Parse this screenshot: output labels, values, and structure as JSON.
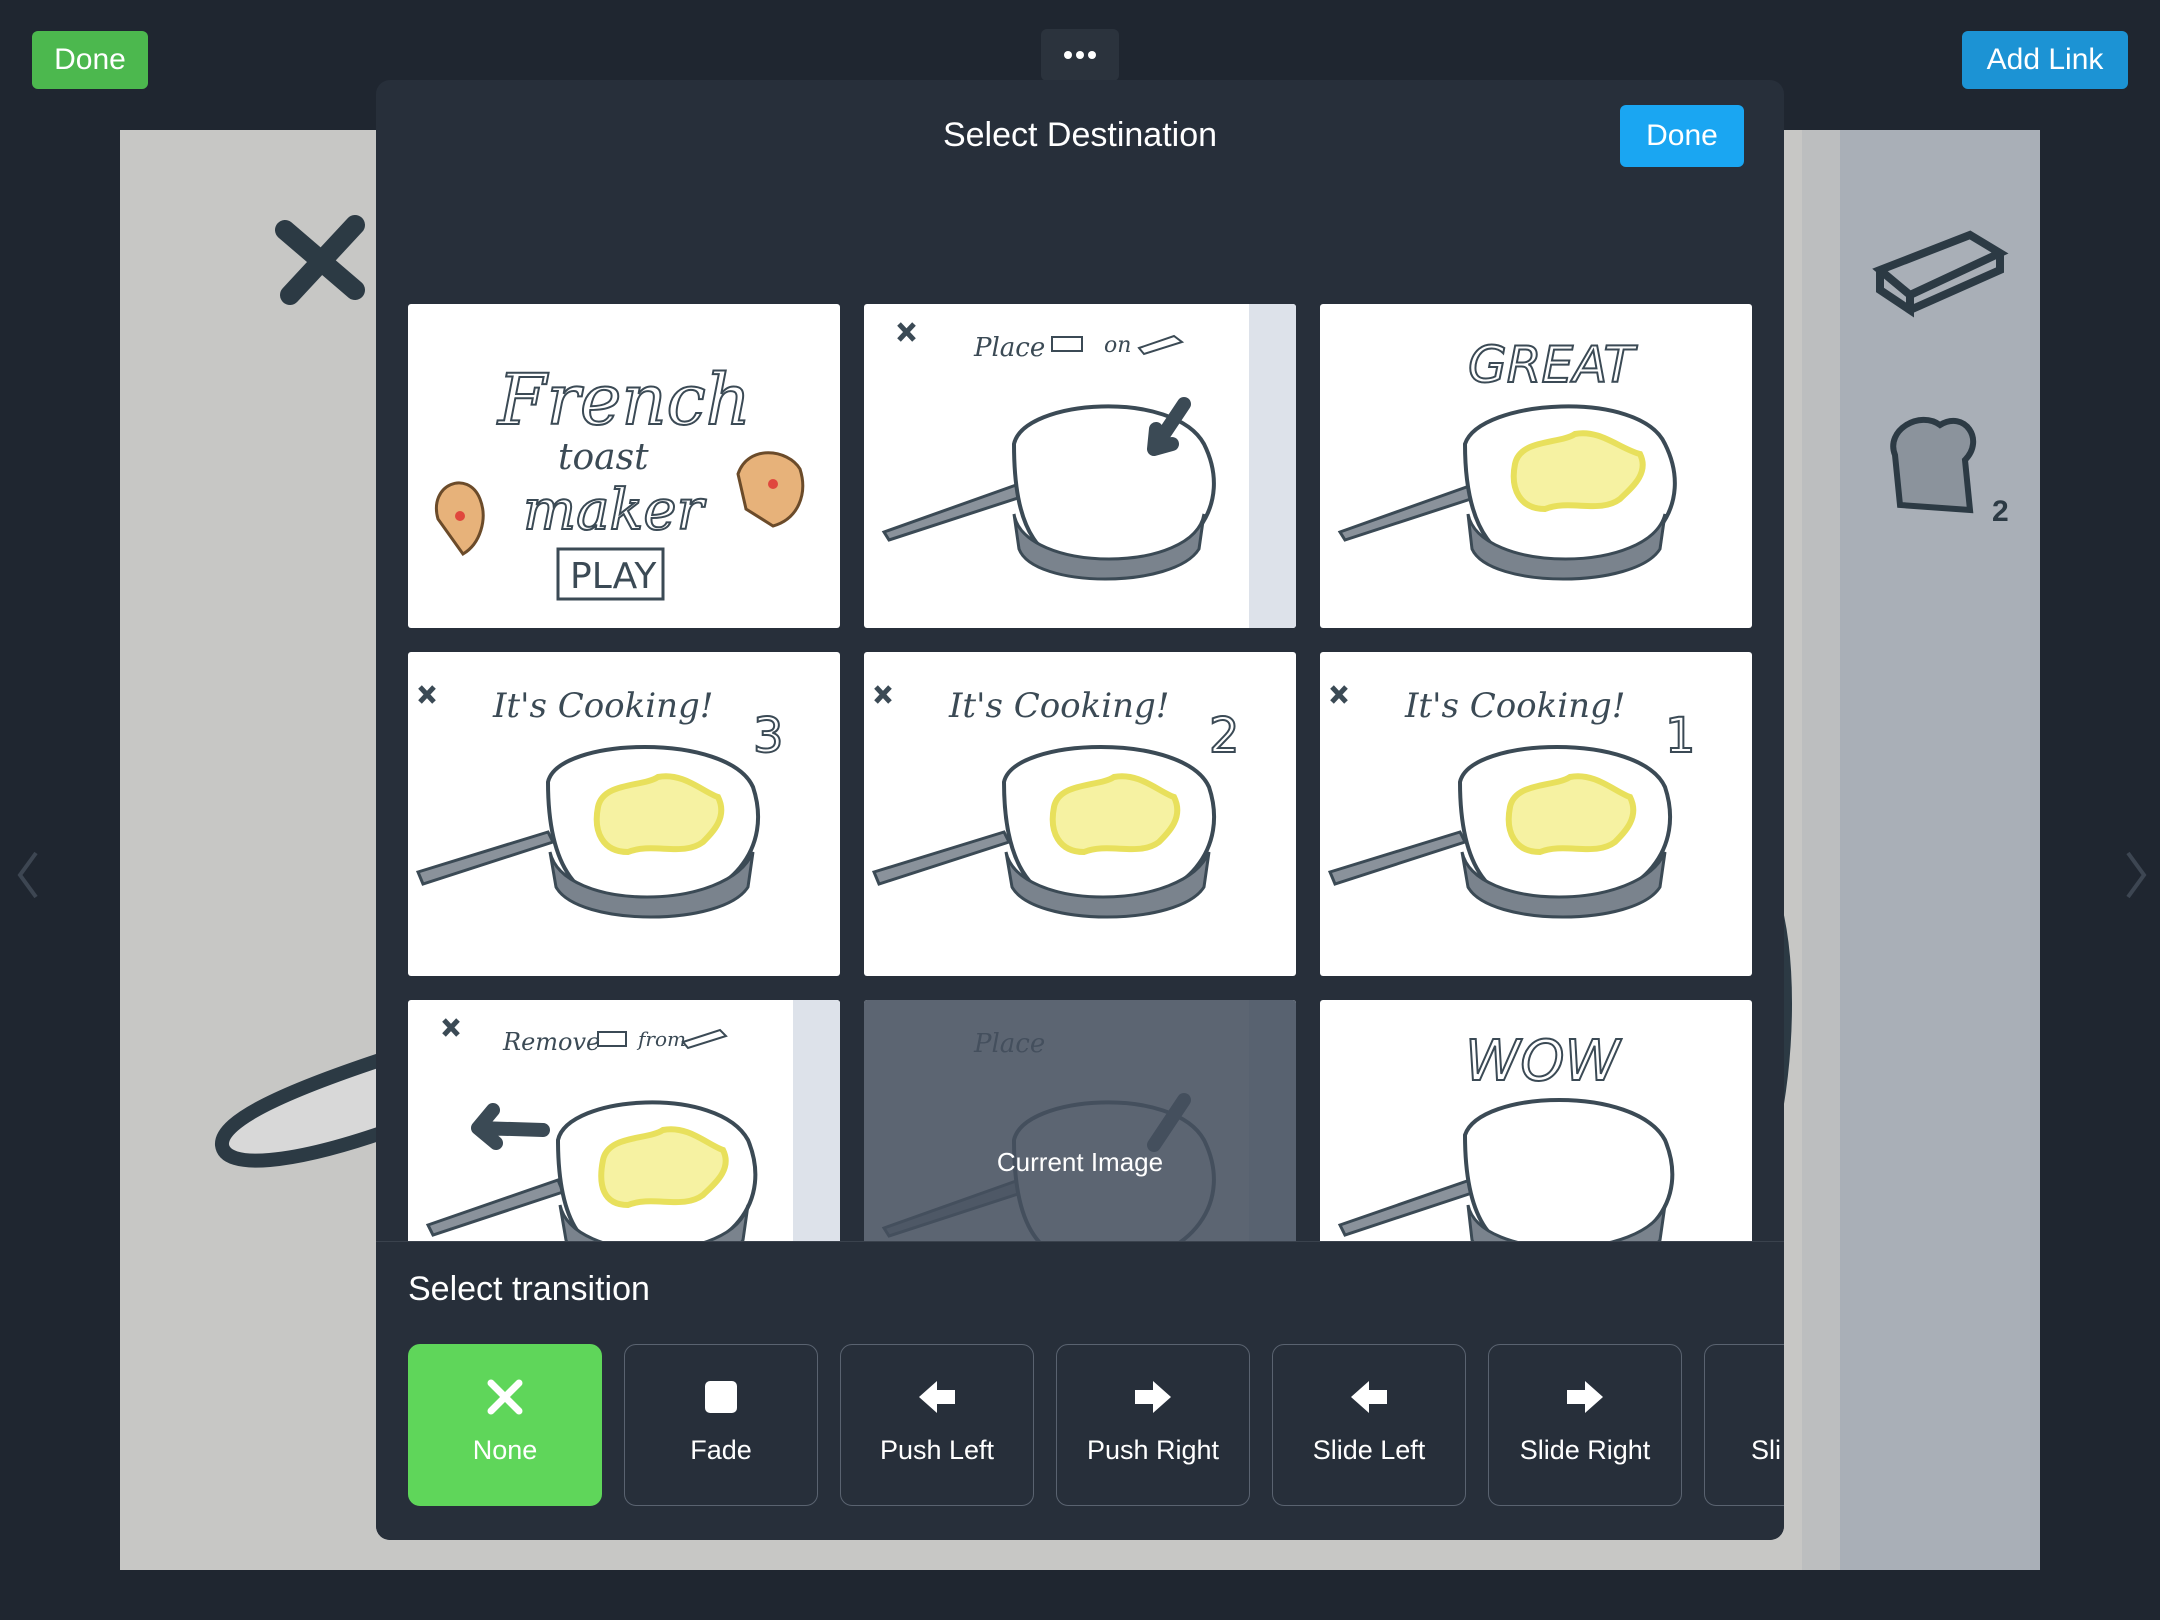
{
  "topbar": {
    "done_label": "Done",
    "more_icon": "ellipsis-icon",
    "add_link_label": "Add Link"
  },
  "canvas": {
    "badge_number": "2"
  },
  "dialog": {
    "title": "Select Destination",
    "done_label": "Done",
    "thumbnails": [
      {
        "scene": "title"
      },
      {
        "scene": "place-butter"
      },
      {
        "scene": "great"
      },
      {
        "scene": "cooking-3"
      },
      {
        "scene": "cooking-2"
      },
      {
        "scene": "cooking-1"
      },
      {
        "scene": "remove-butter"
      },
      {
        "scene": "place-bread",
        "caption": "Current Image"
      },
      {
        "scene": "wow"
      }
    ],
    "transition_title": "Select transition",
    "transitions": [
      {
        "label": "None",
        "icon": "x-icon",
        "selected": true
      },
      {
        "label": "Fade",
        "icon": "square-icon",
        "selected": false
      },
      {
        "label": "Push Left",
        "icon": "arrow-left-icon",
        "selected": false
      },
      {
        "label": "Push Right",
        "icon": "arrow-right-icon",
        "selected": false
      },
      {
        "label": "Slide Left",
        "icon": "arrow-left-icon",
        "selected": false
      },
      {
        "label": "Slide Right",
        "icon": "arrow-right-icon",
        "selected": false
      },
      {
        "label": "Sli",
        "icon": "",
        "selected": false
      }
    ],
    "colors": {
      "selected": "#5fd65a",
      "done_button": "#1aa6f2"
    }
  },
  "colors": {
    "top_done": "#4cb84e",
    "add_link": "#1c93d4"
  }
}
